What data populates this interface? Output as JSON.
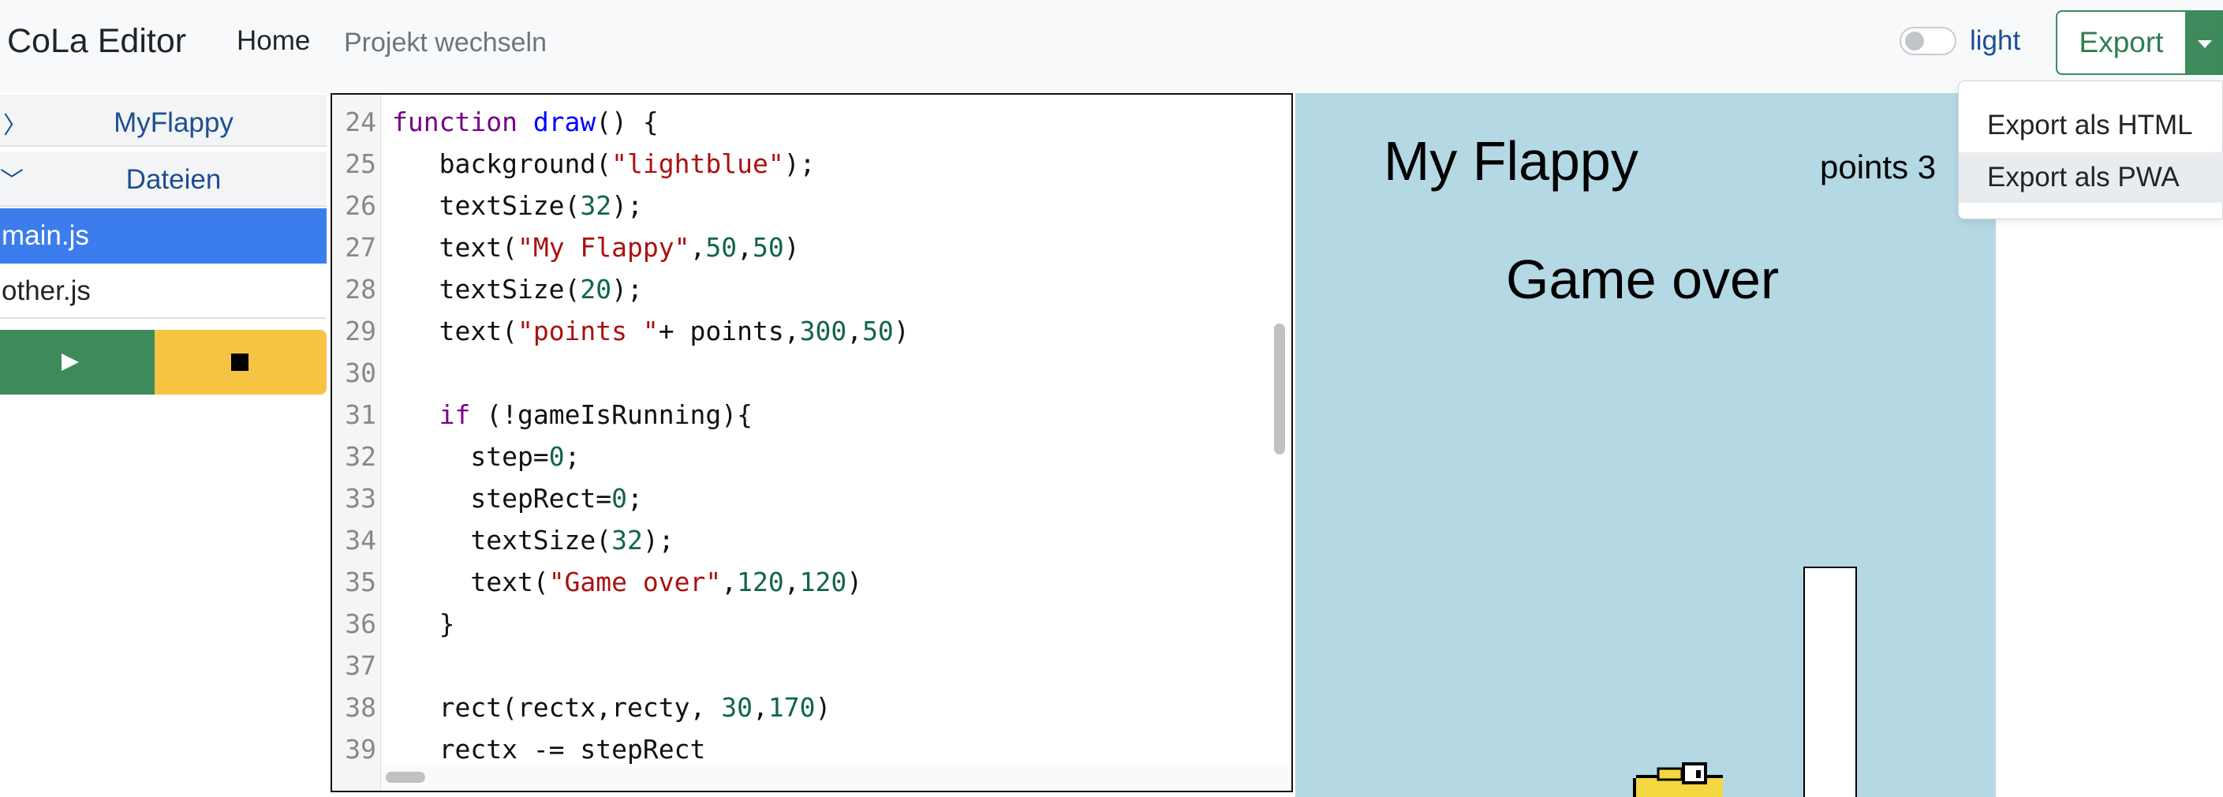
{
  "navbar": {
    "brand": "CoLa Editor",
    "home": "Home",
    "switch_project": "Projekt wechseln",
    "theme_label": "light",
    "export_label": "Export"
  },
  "export_menu": {
    "items": [
      "Export als HTML",
      "Export als PWA"
    ]
  },
  "sidebar": {
    "project_name": "MyFlappy",
    "files_header": "Dateien",
    "files": [
      "main.js",
      "other.js"
    ],
    "active_file": "main.js"
  },
  "editor": {
    "lines": [
      {
        "n": "24",
        "tokens": [
          [
            "kw",
            "function "
          ],
          [
            "fn",
            "draw"
          ],
          [
            "",
            "() {"
          ]
        ]
      },
      {
        "n": "25",
        "tokens": [
          [
            "",
            "   background("
          ],
          [
            "str",
            "\"lightblue\""
          ],
          [
            "",
            ");"
          ]
        ]
      },
      {
        "n": "26",
        "tokens": [
          [
            "",
            "   textSize("
          ],
          [
            "num",
            "32"
          ],
          [
            "",
            ");"
          ]
        ]
      },
      {
        "n": "27",
        "tokens": [
          [
            "",
            "   text("
          ],
          [
            "str",
            "\"My Flappy\""
          ],
          [
            "",
            ","
          ],
          [
            "num",
            "50"
          ],
          [
            "",
            ","
          ],
          [
            "num",
            "50"
          ],
          [
            "",
            ")"
          ]
        ]
      },
      {
        "n": "28",
        "tokens": [
          [
            "",
            "   textSize("
          ],
          [
            "num",
            "20"
          ],
          [
            "",
            ");"
          ]
        ]
      },
      {
        "n": "29",
        "tokens": [
          [
            "",
            "   text("
          ],
          [
            "str",
            "\"points \""
          ],
          [
            "",
            "+ points,"
          ],
          [
            "num",
            "300"
          ],
          [
            "",
            ","
          ],
          [
            "num",
            "50"
          ],
          [
            "",
            ")"
          ]
        ]
      },
      {
        "n": "30",
        "tokens": []
      },
      {
        "n": "31",
        "tokens": [
          [
            "",
            "   "
          ],
          [
            "kw",
            "if"
          ],
          [
            "",
            " (!gameIsRunning){"
          ]
        ]
      },
      {
        "n": "32",
        "tokens": [
          [
            "",
            "     step="
          ],
          [
            "num",
            "0"
          ],
          [
            "",
            ";"
          ]
        ]
      },
      {
        "n": "33",
        "tokens": [
          [
            "",
            "     stepRect="
          ],
          [
            "num",
            "0"
          ],
          [
            "",
            ";"
          ]
        ]
      },
      {
        "n": "34",
        "tokens": [
          [
            "",
            "     textSize("
          ],
          [
            "num",
            "32"
          ],
          [
            "",
            ");"
          ]
        ]
      },
      {
        "n": "35",
        "tokens": [
          [
            "",
            "     text("
          ],
          [
            "str",
            "\"Game over\""
          ],
          [
            "",
            ","
          ],
          [
            "num",
            "120"
          ],
          [
            "",
            ","
          ],
          [
            "num",
            "120"
          ],
          [
            "",
            ")"
          ]
        ]
      },
      {
        "n": "36",
        "tokens": [
          [
            "",
            "   }"
          ]
        ]
      },
      {
        "n": "37",
        "tokens": []
      },
      {
        "n": "38",
        "tokens": [
          [
            "",
            "   rect(rectx,recty, "
          ],
          [
            "num",
            "30"
          ],
          [
            "",
            ","
          ],
          [
            "num",
            "170"
          ],
          [
            "",
            ")"
          ]
        ]
      },
      {
        "n": "39",
        "tokens": [
          [
            "",
            "   rectx -= stepRect"
          ]
        ]
      }
    ]
  },
  "preview": {
    "title": "My Flappy",
    "points": "points 3",
    "game_over": "Game over"
  },
  "colors": {
    "run": "#3e8a5b",
    "stop": "#f6c343",
    "active_file": "#3b7ded",
    "preview_bg": "#b4d8e4",
    "export": "#2f7d4f"
  }
}
